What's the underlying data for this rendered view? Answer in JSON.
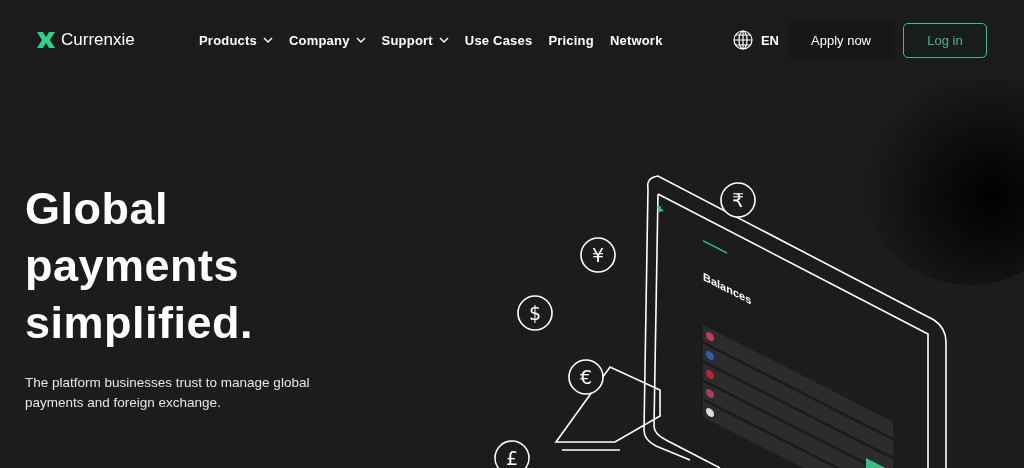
{
  "header": {
    "brand": "Currenxie",
    "nav": [
      {
        "label": "Products",
        "dropdown": true
      },
      {
        "label": "Company",
        "dropdown": true
      },
      {
        "label": "Support",
        "dropdown": true
      },
      {
        "label": "Use Cases",
        "dropdown": false
      },
      {
        "label": "Pricing",
        "dropdown": false
      },
      {
        "label": "Network",
        "dropdown": false
      }
    ],
    "language": "EN",
    "apply_button": "Apply now",
    "login_button": "Log in"
  },
  "hero": {
    "headline": "Global payments simplified.",
    "subtitle": "The platform businesses trust to manage global payments and foreign exchange.",
    "illustration": {
      "screen_title": "Balances",
      "currency_symbols": [
        "₹",
        "¥",
        "$",
        "€",
        "£"
      ]
    }
  }
}
